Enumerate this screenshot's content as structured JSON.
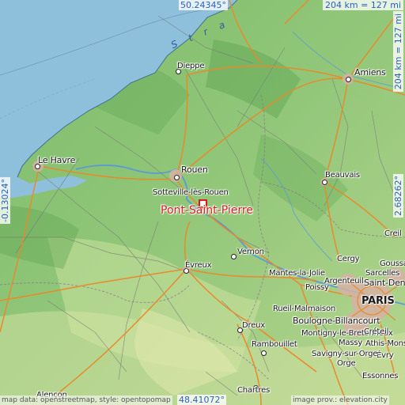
{
  "map": {
    "focus_place": "Pont-Saint-Pierre",
    "water_label": "S t r a",
    "coords": {
      "top": "50.24345°",
      "bottom": "48.41072°",
      "left": "-0.13024°",
      "right": "2.68262°"
    },
    "scale": {
      "horizontal": "204 km = 127 mi",
      "vertical": "204 km = 127 mi"
    },
    "attribution_left": "map data: openstreetmap, style: opentopomap",
    "attribution_right": "image prov.: elevation.city",
    "places": [
      {
        "name": "Dieppe"
      },
      {
        "name": "Amiens"
      },
      {
        "name": "Le Havre"
      },
      {
        "name": "Rouen"
      },
      {
        "name": "Sotteville-lès-Rouen"
      },
      {
        "name": "Beauvais"
      },
      {
        "name": "Vernon"
      },
      {
        "name": "Évreux"
      },
      {
        "name": "Cergy"
      },
      {
        "name": "Creil"
      },
      {
        "name": "Goussainville"
      },
      {
        "name": "Sarcelles"
      },
      {
        "name": "Argenteuil"
      },
      {
        "name": "Poissy"
      },
      {
        "name": "Mantes-la-Jolie"
      },
      {
        "name": "Saint-Denis"
      },
      {
        "name": "PARIS"
      },
      {
        "name": "Rueil-Malmaison"
      },
      {
        "name": "Boulogne-Billancourt"
      },
      {
        "name": "Montigny-le-Bretonneux"
      },
      {
        "name": "Massy"
      },
      {
        "name": "Créteil"
      },
      {
        "name": "Athis-Mons"
      },
      {
        "name": "Évry"
      },
      {
        "name": "Savigny-sur-Orge"
      },
      {
        "name": "Orge"
      },
      {
        "name": "Rambouillet"
      },
      {
        "name": "Dreux"
      },
      {
        "name": "Chartres"
      },
      {
        "name": "Essonnes"
      },
      {
        "name": "Alençon"
      }
    ]
  }
}
